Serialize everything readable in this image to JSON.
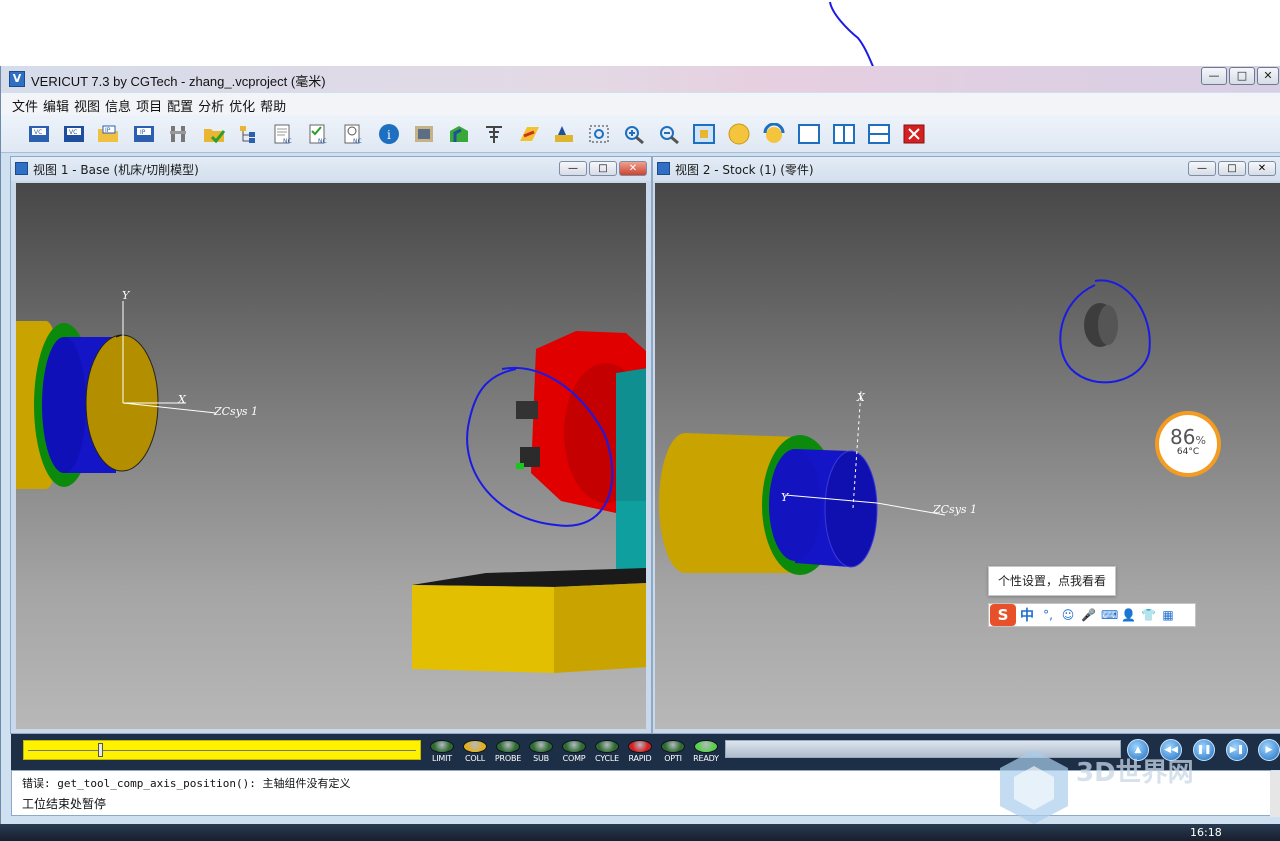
{
  "window": {
    "title": "VERICUT 7.3 by CGTech - zhang_.vcproject (毫米)",
    "min_glyph": "—",
    "max_glyph": "□",
    "close_glyph": "✕"
  },
  "menu": [
    "文件",
    "编辑",
    "视图",
    "信息",
    "项目",
    "配置",
    "分析",
    "优化",
    "帮助"
  ],
  "toolbar_icons": [
    "vc-new-icon",
    "vc-save-icon",
    "ip-open-icon",
    "ip-save-icon",
    "machine-tool-icon",
    "open-folder-icon",
    "model-tree-icon",
    "nc-program-icon",
    "nc-check-icon",
    "nc-search-icon",
    "info-icon",
    "report-icon",
    "cut-stock-icon",
    "tool-manager-icon",
    "playback-icon",
    "stock-view-icon",
    "zoom-box-icon",
    "zoom-in-icon",
    "zoom-out-icon",
    "fit-icon",
    "shade-icon",
    "rotate-icon",
    "single-layout-icon",
    "vertical-split-icon",
    "horizontal-split-icon",
    "close-red-icon"
  ],
  "view1": {
    "title": "视图 1 - Base (机床/切削模型)",
    "axis_y": "Y",
    "axis_x": "X",
    "csys": "ZCsys 1"
  },
  "view2": {
    "title": "视图 2 - Stock (1) (零件)",
    "axis_x": "X",
    "axis_y": "Y",
    "csys": "ZCsys 1"
  },
  "status_leds": [
    {
      "label": "LIMIT",
      "color": "#2f6b2f"
    },
    {
      "label": "COLL",
      "color": "#e0b020"
    },
    {
      "label": "PROBE",
      "color": "#2f6b2f"
    },
    {
      "label": "SUB",
      "color": "#2f6b2f"
    },
    {
      "label": "COMP",
      "color": "#2f6b2f"
    },
    {
      "label": "CYCLE",
      "color": "#2f6b2f"
    },
    {
      "label": "RAPID",
      "color": "#d42020"
    },
    {
      "label": "OPTI",
      "color": "#2f6b2f"
    },
    {
      "label": "READY",
      "color": "#5ad04a"
    }
  ],
  "slider_position": 0.19,
  "playback": [
    "▲",
    "◀◀",
    "❚❚",
    "▶❚",
    "▶"
  ],
  "log": {
    "error": "错误: get_tool_comp_axis_position(): 主轴组件没有定义",
    "info": "工位结束处暂停"
  },
  "tooltip": "个性设置，点我看看",
  "ime": {
    "logo": "S",
    "mode": "中",
    "punct": "°,",
    "icons": [
      "☺",
      "🎤",
      "⌨",
      "👤",
      "👕",
      "▦"
    ]
  },
  "cpu_widget": {
    "percent": "86",
    "unit": "%",
    "temp": "64°C"
  },
  "taskbar_time": "16:18",
  "watermark": "3D世界网",
  "colors": {
    "accent": "#f39c22",
    "titlebar": "#dfd4e6",
    "bottom": "#1d2f47",
    "slider": "#fff200"
  }
}
